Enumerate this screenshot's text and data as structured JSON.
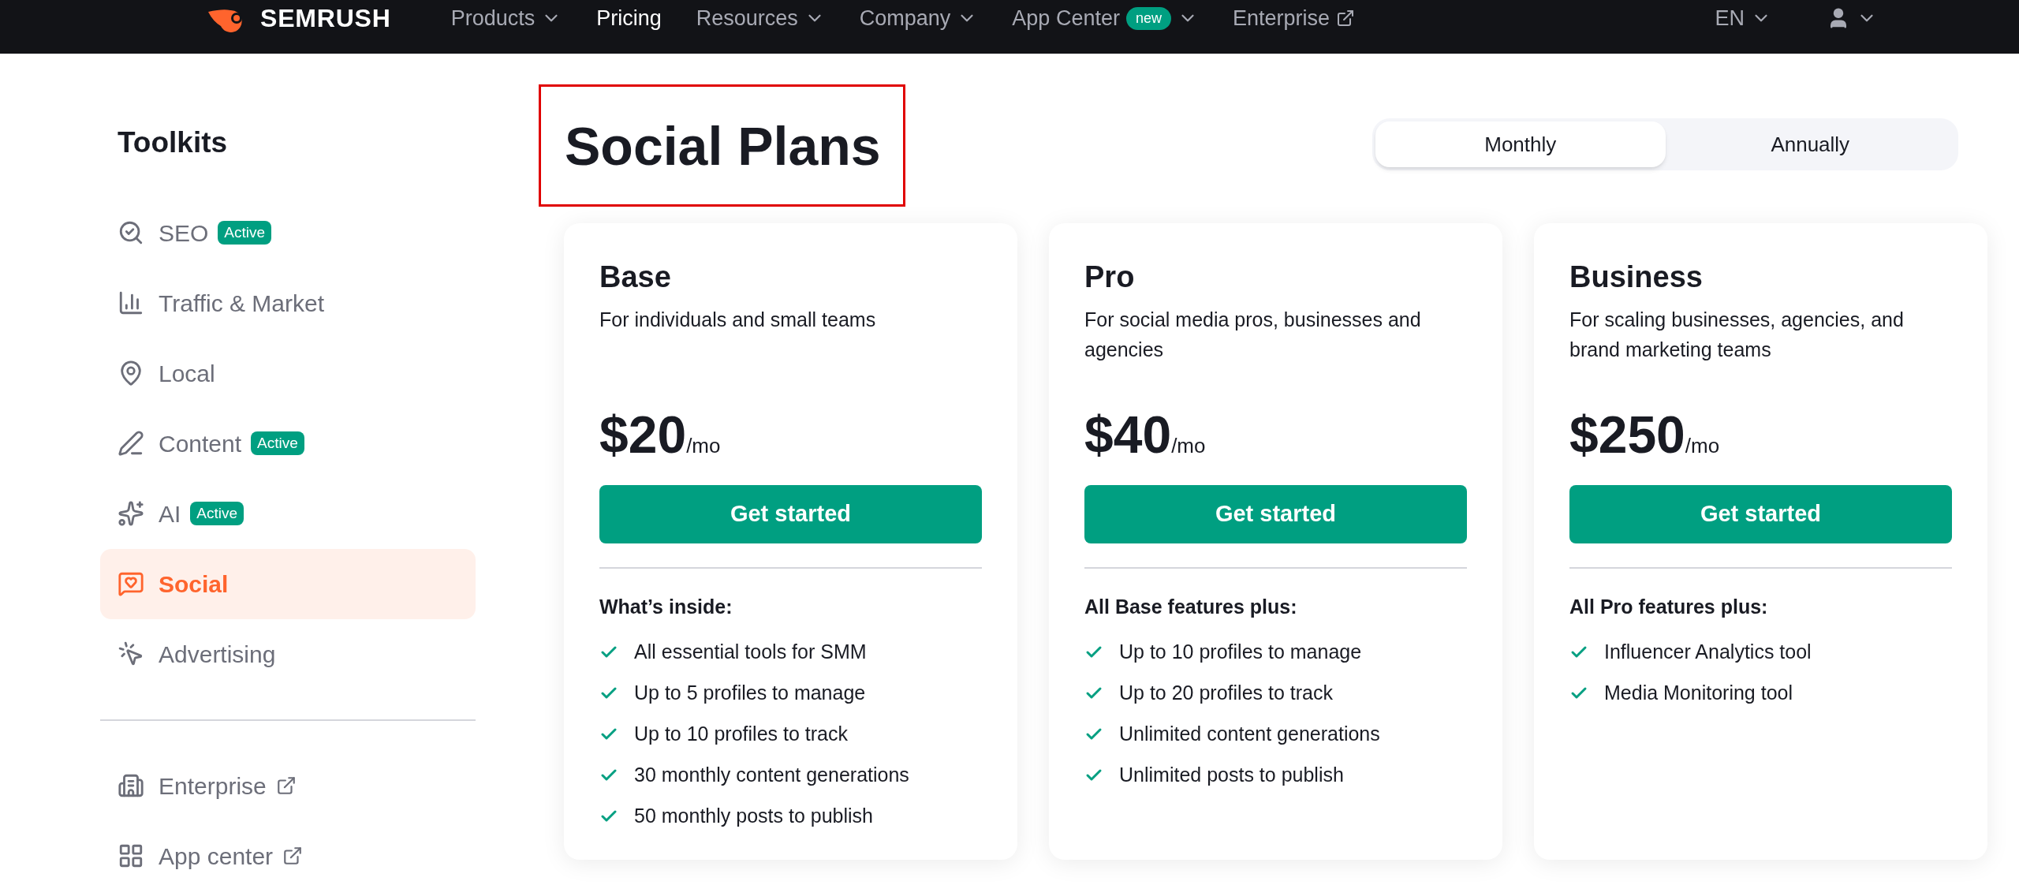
{
  "nav": {
    "logo": "SEMRUSH",
    "items": [
      {
        "label": "Products",
        "selected": false,
        "menu": true,
        "external": false
      },
      {
        "label": "Pricing",
        "selected": true,
        "menu": false,
        "external": false
      },
      {
        "label": "Resources",
        "selected": false,
        "menu": true,
        "external": false
      },
      {
        "label": "Company",
        "selected": false,
        "menu": true,
        "external": false
      },
      {
        "label": "App Center",
        "selected": false,
        "menu": true,
        "external": false,
        "badge": "new"
      },
      {
        "label": "Enterprise",
        "selected": false,
        "menu": false,
        "external": true
      }
    ],
    "language": "EN"
  },
  "sidebar": {
    "title": "Toolkits",
    "items": [
      {
        "label": "SEO",
        "selected": false,
        "badge": "Active"
      },
      {
        "label": "Traffic & Market",
        "selected": false
      },
      {
        "label": "Local",
        "selected": false
      },
      {
        "label": "Content",
        "selected": false,
        "badge": "Active"
      },
      {
        "label": "AI",
        "selected": false,
        "badge": "Active"
      },
      {
        "label": "Social",
        "selected": true
      },
      {
        "label": "Advertising",
        "selected": false
      }
    ],
    "links": [
      {
        "label": "Enterprise",
        "external": true
      },
      {
        "label": "App center",
        "external": true
      }
    ]
  },
  "title": "Social Plans",
  "title_highlighted": true,
  "billing_toggle": [
    {
      "label": "Monthly",
      "selected": true
    },
    {
      "label": "Annually",
      "selected": false
    }
  ],
  "plans": [
    {
      "name": "Base",
      "description": "For individuals and small teams",
      "price": "$20",
      "period": "/mo",
      "button": "Get started",
      "features_heading": "What’s inside:",
      "features": [
        "All essential tools for SMM",
        "Up to 5 profiles to manage",
        "Up to 10 profiles to track",
        "30 monthly content generations",
        "50 monthly posts to publish"
      ]
    },
    {
      "name": "Pro",
      "description": "For social media pros, businesses and agencies",
      "price": "$40",
      "period": "/mo",
      "button": "Get started",
      "features_heading": "All Base features plus:",
      "features": [
        "Up to 10 profiles to manage",
        "Up to 20 profiles to track",
        "Unlimited content generations",
        "Unlimited posts to publish"
      ]
    },
    {
      "name": "Business",
      "description": "For scaling businesses, agencies, and brand marketing teams",
      "price": "$250",
      "period": "/mo",
      "button": "Get started",
      "features_heading": "All Pro features plus:",
      "features": [
        "Influencer Analytics tool",
        "Media Monitoring tool"
      ]
    }
  ]
}
